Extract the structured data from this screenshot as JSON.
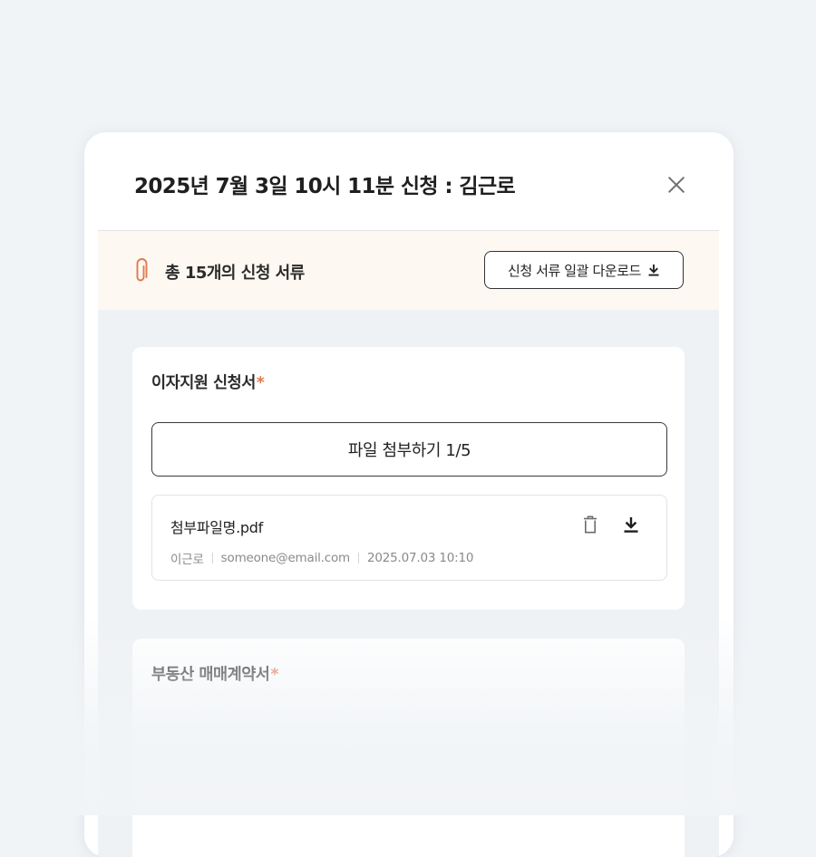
{
  "modal": {
    "title": "2025년 7월 3일 10시 11분 신청 : 김근로",
    "close_icon": "close-icon"
  },
  "summary": {
    "text": "총 15개의 신청 서류",
    "icon": "paperclip-icon",
    "download_all_label": "신청 서류 일괄 다운로드",
    "download_icon": "download-icon"
  },
  "documents": [
    {
      "title": "이자지원 신청서",
      "required_mark": "*",
      "attach_label": "파일 첨부하기 1/5",
      "files": [
        {
          "name": "첨부파일명.pdf",
          "uploader": "이근로",
          "email": "someone@email.com",
          "date": "2025.07.03 10:10",
          "delete_icon": "trash-icon",
          "download_icon": "download-icon"
        }
      ]
    },
    {
      "title": "부동산 매매계약서",
      "required_mark": "*"
    }
  ],
  "colors": {
    "page_bg": "#f1f4f7",
    "summary_bg": "#fdf8f1",
    "content_bg": "#eff2f4",
    "accent": "#e07a4f"
  }
}
